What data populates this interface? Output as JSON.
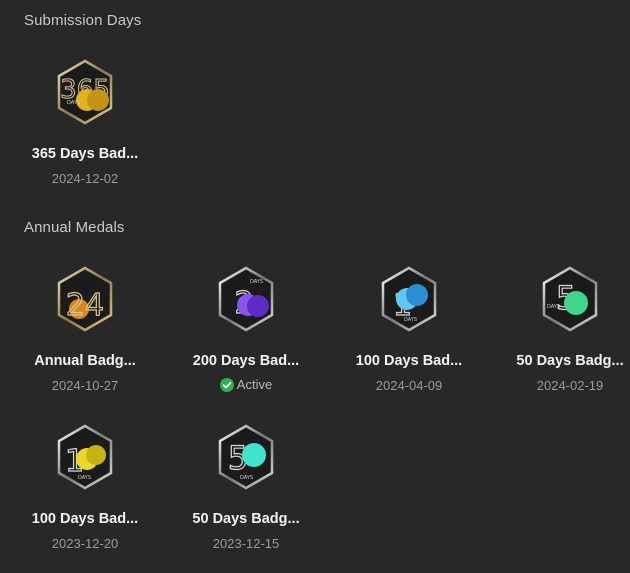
{
  "sections": [
    {
      "title": "Submission Days",
      "badges": [
        {
          "name": "365 Days Bad...",
          "date": "2024-12-02",
          "icon": "badge-365-days-icon",
          "numeral": "365",
          "accent": "#e0b21c",
          "accent2": "#c49312"
        }
      ]
    },
    {
      "title": "Annual Medals",
      "badges": [
        {
          "name": "Annual Badg...",
          "date": "2024-10-27",
          "icon": "badge-annual-24-icon",
          "numeral": "24",
          "accent": "#d9861f",
          "accent2": "#b86a10"
        },
        {
          "name": "200 Days Bad...",
          "status": "Active",
          "icon": "badge-200-days-icon",
          "numeral": "200",
          "accent": "#8a55e8",
          "accent2": "#5b2cc7"
        },
        {
          "name": "100 Days Bad...",
          "date": "2024-04-09",
          "icon": "badge-100-days-icon",
          "numeral": "100",
          "accent": "#5fc7f2",
          "accent2": "#2a8fd6"
        },
        {
          "name": "50 Days Badg...",
          "date": "2024-02-19",
          "icon": "badge-50-days-icon",
          "numeral": "50",
          "accent": "#3fd68a",
          "accent2": "#1fa85e"
        },
        {
          "name": "100 Days Bad...",
          "date": "2023-12-20",
          "icon": "badge-100-days-2023-icon",
          "numeral": "100",
          "accent": "#ecd62a",
          "accent2": "#c9b112"
        },
        {
          "name": "50 Days Badg...",
          "date": "2023-12-15",
          "icon": "badge-50-days-2023-icon",
          "numeral": "50",
          "accent": "#3fe3d0",
          "accent2": "#1db8a8"
        }
      ]
    }
  ],
  "colors": {
    "background": "#282828",
    "active_check": "#2fb14f"
  }
}
